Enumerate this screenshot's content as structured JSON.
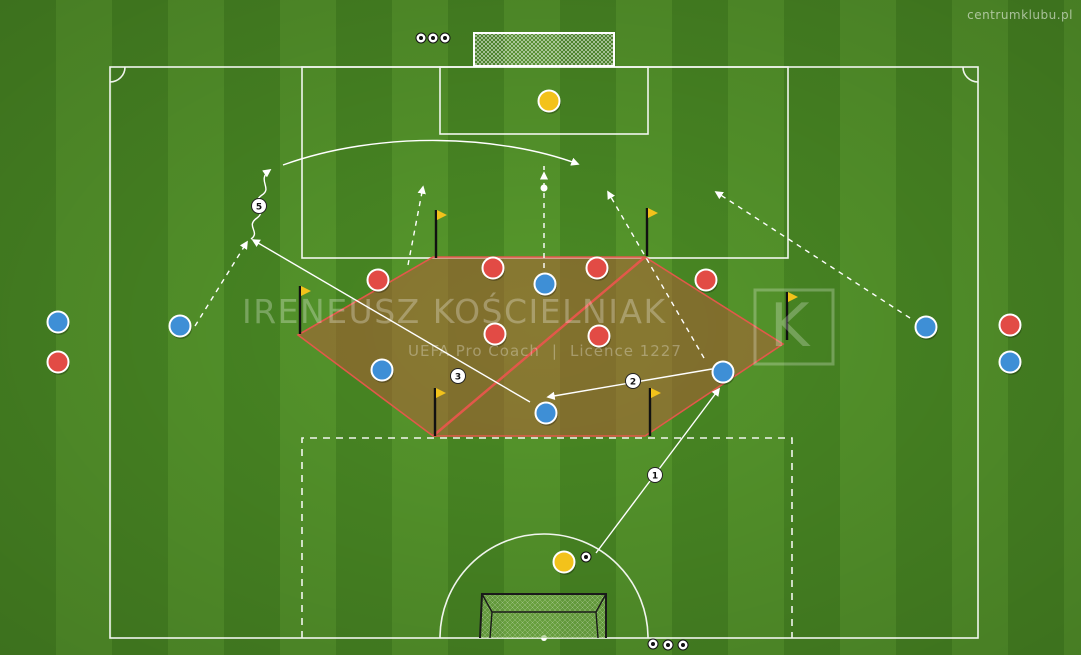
{
  "credit": "centrumklubu.pl",
  "watermark": {
    "name": "IRENEUSZ KOŚCIELNIAK",
    "role": "UEFA Pro Coach",
    "separator": "|",
    "licence": "Licence 1227",
    "logo_letter": "K"
  },
  "step_labels": [
    "1",
    "2",
    "3",
    "5"
  ],
  "colors": {
    "blue_team": "#3e8fd6",
    "red_team": "#e24b45",
    "goalkeeper": "#f3c21b",
    "zone_fill": "#c6543a",
    "zone_line": "#e2584a",
    "flag": "#f2c21b",
    "lines": "#ffffff"
  },
  "icons": {
    "flag": "corner-flag-icon",
    "ball": "soccer-ball-icon",
    "goal": "goal-net-icon"
  }
}
